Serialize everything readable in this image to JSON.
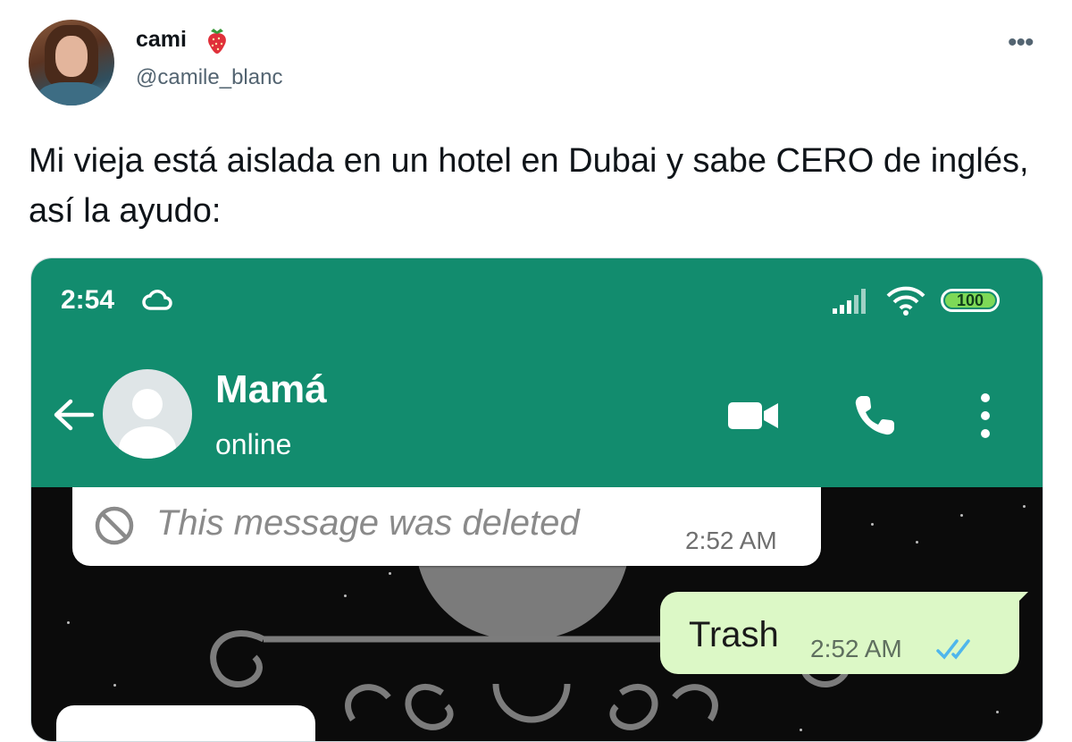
{
  "tweet": {
    "display_name": "cami",
    "handle": "@camile_blanc",
    "text": "Mi vieja está aislada en un hotel en Dubai y sabe CERO de inglés, así la ayudo:",
    "more_icon": "more-horizontal-icon",
    "emoji_icon": "strawberry-icon"
  },
  "phone": {
    "status_bar": {
      "time": "2:54",
      "battery": "100",
      "icons": [
        "cloud-icon",
        "signal-icon",
        "wifi-icon",
        "battery-icon"
      ]
    },
    "chat_header": {
      "contact_name": "Mamá",
      "contact_status": "online",
      "icons": [
        "back-arrow-icon",
        "video-call-icon",
        "phone-call-icon",
        "more-vertical-icon"
      ]
    },
    "messages": [
      {
        "direction": "incoming",
        "text": "This message was deleted",
        "time": "2:52 AM",
        "icon": "ban-icon"
      },
      {
        "direction": "outgoing",
        "text": "Trash",
        "time": "2:52 AM",
        "icon": "double-check-icon"
      }
    ]
  },
  "colors": {
    "whatsapp_green": "#128c6e",
    "outgoing_bubble": "#dcf8c6",
    "read_ticks": "#4fb6ec",
    "twitter_text": "#0f1419",
    "twitter_secondary": "#536471"
  }
}
